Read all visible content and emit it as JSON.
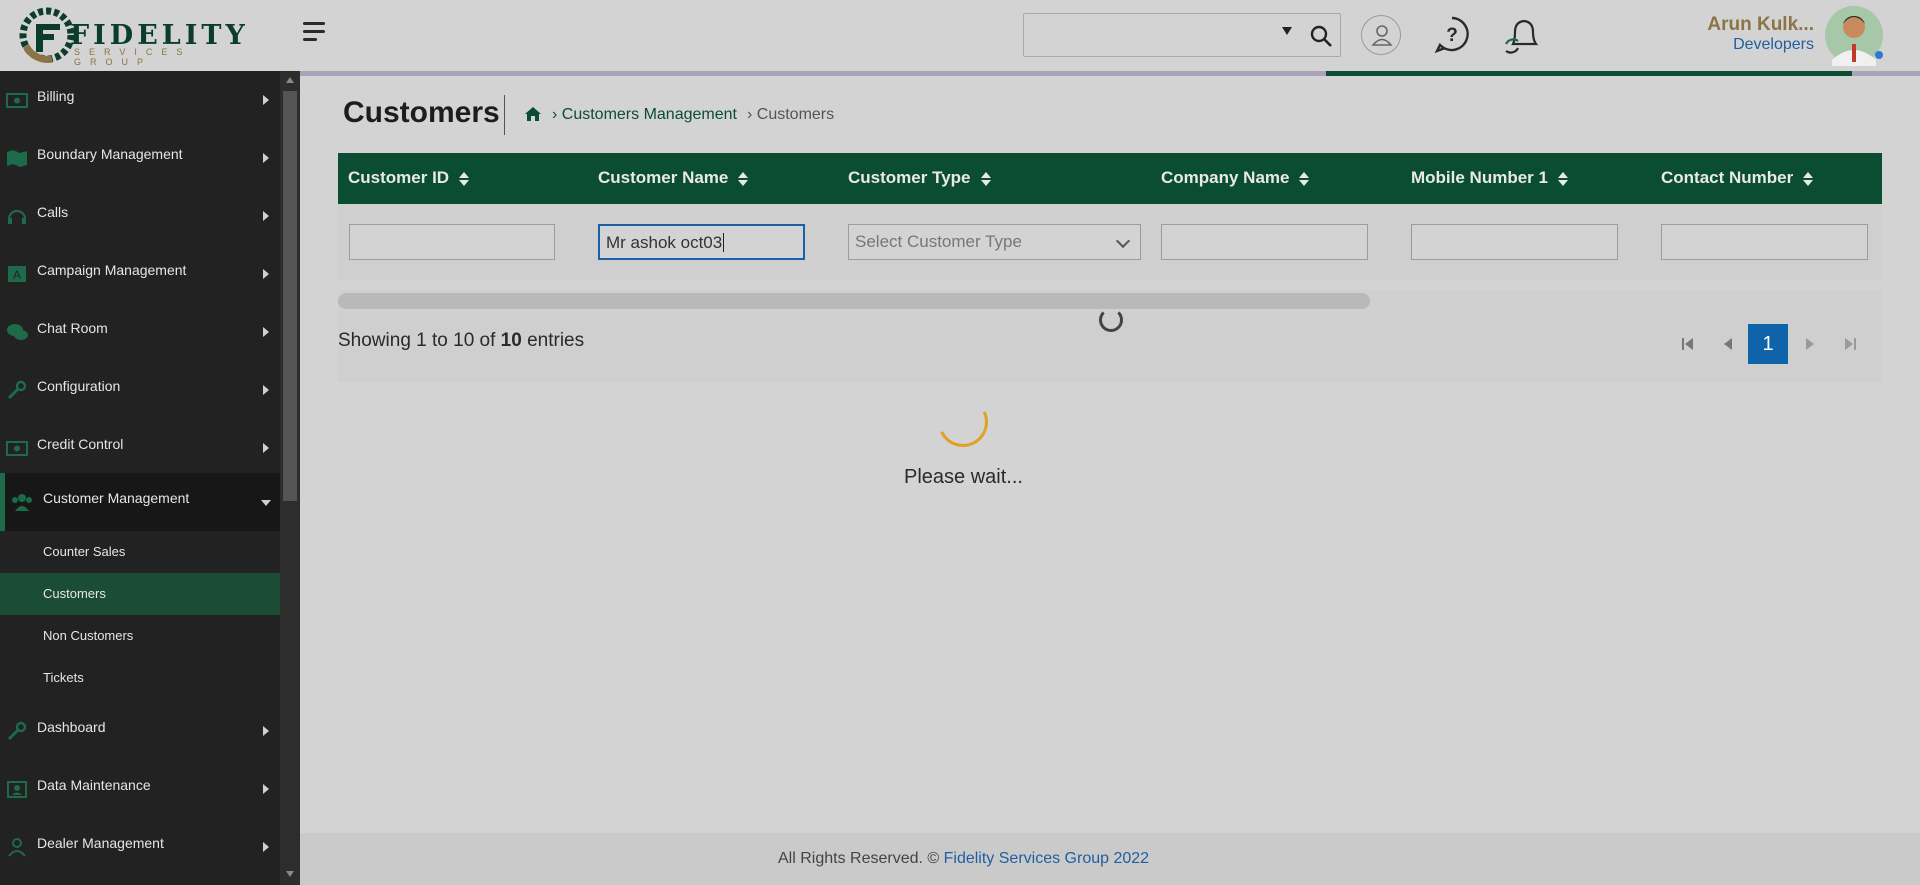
{
  "header": {
    "logo_text": "FIDELITY",
    "logo_subtext": "SERVICES GROUP",
    "user_name": "Arun Kulk...",
    "user_role": "Developers"
  },
  "sidebar": {
    "items": [
      {
        "label": "Billing",
        "icon": "money-icon"
      },
      {
        "label": "Boundary Management",
        "icon": "map-icon"
      },
      {
        "label": "Calls",
        "icon": "headset-icon"
      },
      {
        "label": "Campaign Management",
        "icon": "campaign-icon"
      },
      {
        "label": "Chat Room",
        "icon": "chat-icon"
      },
      {
        "label": "Configuration",
        "icon": "wrench-icon"
      },
      {
        "label": "Credit Control",
        "icon": "money-icon"
      },
      {
        "label": "Customer Management",
        "icon": "users-icon"
      },
      {
        "label": "Dashboard",
        "icon": "wrench-icon"
      },
      {
        "label": "Data Maintenance",
        "icon": "id-card-icon"
      },
      {
        "label": "Dealer Management",
        "icon": "user-icon"
      }
    ],
    "subitems": [
      {
        "label": "Counter Sales"
      },
      {
        "label": "Customers"
      },
      {
        "label": "Non Customers"
      },
      {
        "label": "Tickets"
      }
    ]
  },
  "page": {
    "title": "Customers",
    "breadcrumb": [
      "› Customers Management",
      "› Customers"
    ]
  },
  "table": {
    "columns": [
      "Customer ID",
      "Customer Name",
      "Customer Type",
      "Company Name",
      "Mobile Number 1",
      "Contact Number"
    ],
    "filters": {
      "customer_id": "",
      "customer_name": "Mr ashok oct03",
      "customer_type_placeholder": "Select Customer Type",
      "company_name": "",
      "mobile_number": "",
      "contact_number": ""
    }
  },
  "pagination": {
    "info_prefix": "Showing 1 to 10 of ",
    "info_total": "10",
    "info_suffix": " entries",
    "current_page": "1"
  },
  "loading": {
    "text": "Please wait..."
  },
  "footer": {
    "prefix": "All Rights Reserved. © ",
    "link": "Fidelity Services Group 2022"
  },
  "colors": {
    "brand_green": "#0b4d33",
    "accent_gold": "#8b7446",
    "link_blue": "#1f5f9f",
    "sidebar_bg": "#222222"
  }
}
